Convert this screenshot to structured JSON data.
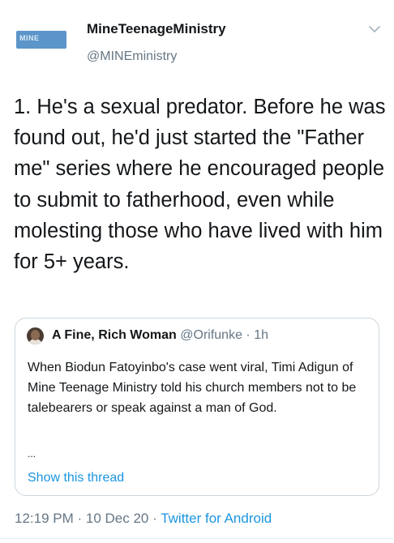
{
  "author": {
    "display_name": "MineTeenageMinistry",
    "handle": "@MINEministry",
    "avatar_icon": "logo-avatar"
  },
  "tweet": {
    "text": "1. He's a sexual predator. Before he was found out, he'd just started the \"Father me\" series where he encouraged people to submit to fatherhood, even while molesting those who have lived with him for 5+ years."
  },
  "quote": {
    "display_name": "A Fine, Rich Woman",
    "handle": "@Orifunke",
    "separator": " · ",
    "time": "1h",
    "text": "When Biodun Fatoyinbo's case went viral, Timi Adigun of Mine Teenage Ministry told his church members not to be talebearers or speak against a man of God.",
    "ellipsis": "...",
    "show_thread_label": "Show this thread"
  },
  "meta": {
    "time": "12:19 PM",
    "sep1": " · ",
    "date": "10 Dec 20",
    "sep2": " · ",
    "source": "Twitter for Android"
  },
  "colors": {
    "link": "#1b95e0",
    "muted": "#657786",
    "border": "#ccd6dd"
  },
  "icons": {
    "more": "chevron-down-icon"
  }
}
